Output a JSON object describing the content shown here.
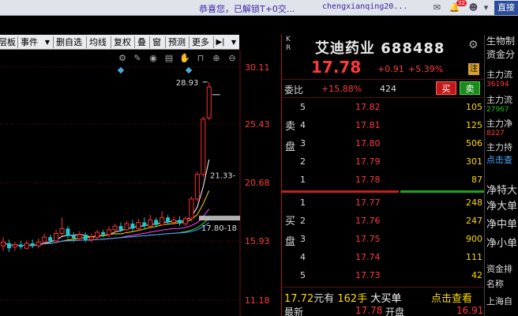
{
  "topbar": {
    "message": "恭喜您，已解锁T+0交...",
    "user": "chengxianqing20...",
    "mail_badge": "32",
    "back_label": "直接"
  },
  "chart_toolbar": {
    "items": [
      "层板",
      "事件",
      "删自选",
      "均线",
      "复权",
      "叠",
      "窗",
      "预测",
      "更多"
    ]
  },
  "chart_icons": [
    "settings-gear-icon",
    "pencil-icon",
    "eye-icon",
    "clipboard-icon",
    "hand-icon",
    "lock-icon",
    "zoom-in-icon",
    "zoom-out-icon"
  ],
  "chart_data": {
    "type": "candlestick",
    "y_axis_ticks": [
      "30.11",
      "25.43",
      "20.68",
      "15.93",
      "11.18"
    ],
    "annotations": {
      "high_marker": "28.93",
      "ma_label": "21.33-",
      "price_range_label": "17.80-18"
    },
    "candles": [
      {
        "o": 15.6,
        "c": 15.9,
        "h": 16.3,
        "l": 15.2
      },
      {
        "o": 15.8,
        "c": 15.4,
        "h": 16.1,
        "l": 15.1
      },
      {
        "o": 15.5,
        "c": 15.7,
        "h": 15.9,
        "l": 15.2
      },
      {
        "o": 15.7,
        "c": 15.5,
        "h": 16.0,
        "l": 15.3
      },
      {
        "o": 15.4,
        "c": 15.8,
        "h": 16.0,
        "l": 15.3
      },
      {
        "o": 15.8,
        "c": 15.6,
        "h": 16.1,
        "l": 15.4
      },
      {
        "o": 15.6,
        "c": 15.9,
        "h": 16.2,
        "l": 15.4
      },
      {
        "o": 15.9,
        "c": 16.3,
        "h": 16.6,
        "l": 15.7
      },
      {
        "o": 16.3,
        "c": 16.0,
        "h": 16.5,
        "l": 15.8
      },
      {
        "o": 16.0,
        "c": 16.6,
        "h": 16.9,
        "l": 15.9
      },
      {
        "o": 16.6,
        "c": 17.0,
        "h": 17.9,
        "l": 16.4
      },
      {
        "o": 17.0,
        "c": 16.4,
        "h": 17.2,
        "l": 16.2
      },
      {
        "o": 16.4,
        "c": 16.2,
        "h": 16.7,
        "l": 15.9
      },
      {
        "o": 16.2,
        "c": 16.5,
        "h": 16.8,
        "l": 16.0
      },
      {
        "o": 16.5,
        "c": 16.1,
        "h": 16.7,
        "l": 15.9
      },
      {
        "o": 16.1,
        "c": 16.3,
        "h": 16.6,
        "l": 15.9
      },
      {
        "o": 16.3,
        "c": 16.7,
        "h": 16.9,
        "l": 16.1
      },
      {
        "o": 16.7,
        "c": 16.5,
        "h": 16.9,
        "l": 16.3
      },
      {
        "o": 16.5,
        "c": 16.9,
        "h": 17.2,
        "l": 16.3
      },
      {
        "o": 16.9,
        "c": 17.2,
        "h": 17.4,
        "l": 16.7
      },
      {
        "o": 17.2,
        "c": 16.9,
        "h": 17.5,
        "l": 16.7
      },
      {
        "o": 16.9,
        "c": 17.4,
        "h": 17.6,
        "l": 16.8
      },
      {
        "o": 17.4,
        "c": 17.0,
        "h": 17.7,
        "l": 16.8
      },
      {
        "o": 17.0,
        "c": 17.5,
        "h": 17.8,
        "l": 16.9
      },
      {
        "o": 17.5,
        "c": 17.2,
        "h": 17.9,
        "l": 17.0
      },
      {
        "o": 17.2,
        "c": 17.7,
        "h": 18.1,
        "l": 17.0
      },
      {
        "o": 17.7,
        "c": 17.3,
        "h": 17.9,
        "l": 17.1
      },
      {
        "o": 17.3,
        "c": 17.9,
        "h": 18.4,
        "l": 17.2
      },
      {
        "o": 17.9,
        "c": 17.5,
        "h": 18.1,
        "l": 17.3
      },
      {
        "o": 17.5,
        "c": 17.7,
        "h": 18.0,
        "l": 17.3
      },
      {
        "o": 17.7,
        "c": 17.4,
        "h": 18.0,
        "l": 17.2
      },
      {
        "o": 17.4,
        "c": 17.8,
        "h": 18.0,
        "l": 17.2
      },
      {
        "o": 17.8,
        "c": 19.4,
        "h": 19.6,
        "l": 17.6
      },
      {
        "o": 19.4,
        "c": 21.4,
        "h": 21.6,
        "l": 19.2
      },
      {
        "o": 21.4,
        "c": 25.9,
        "h": 26.1,
        "l": 21.2
      },
      {
        "o": 26.0,
        "c": 28.5,
        "h": 28.9,
        "l": 25.8
      }
    ]
  },
  "quote": {
    "kr_labels": [
      "K",
      "R"
    ],
    "name": "艾迪药业",
    "code": "688488",
    "last_price": "17.78",
    "change": "+0.91",
    "change_pct": "+5.39%",
    "zhu_label": "注",
    "weibi_label": "委比",
    "weibi_value": "+15.88%",
    "weibi_count": "424",
    "buy_btn": "买",
    "sell_btn": "卖",
    "sell_side_label": [
      "卖",
      "盘"
    ],
    "buy_side_label": [
      "买",
      "盘"
    ],
    "asks": [
      {
        "level": "5",
        "price": "17.82",
        "vol": "105"
      },
      {
        "level": "4",
        "price": "17.81",
        "vol": "125"
      },
      {
        "level": "3",
        "price": "17.80",
        "vol": "506"
      },
      {
        "level": "2",
        "price": "17.79",
        "vol": "301"
      },
      {
        "level": "1",
        "price": "17.78",
        "vol": "87"
      }
    ],
    "bids": [
      {
        "level": "1",
        "price": "17.77",
        "vol": "248"
      },
      {
        "level": "2",
        "price": "17.76",
        "vol": "247"
      },
      {
        "level": "3",
        "price": "17.75",
        "vol": "900"
      },
      {
        "level": "4",
        "price": "17.74",
        "vol": "111"
      },
      {
        "level": "5",
        "price": "17.73",
        "vol": "42"
      }
    ],
    "bottom": {
      "price": "17.72",
      "unit_yuan": "元有",
      "qty": "162手",
      "big_buy": "大买单",
      "click_view": "点击查看"
    },
    "last_row": {
      "label_latest": "最新",
      "latest": "17.78",
      "label_open": "开盘",
      "open": "16.91"
    }
  },
  "strip": {
    "items": [
      {
        "text": "生物制",
        "color": "#dddddd"
      },
      {
        "text": "资金分",
        "color": "#dddddd"
      },
      {
        "text": "主力流",
        "color": "#dddddd"
      },
      {
        "text": "36194",
        "color": "#ff3a3a"
      },
      {
        "text": "主力流",
        "color": "#dddddd"
      },
      {
        "text": "27967",
        "color": "#20c020"
      },
      {
        "text": "主力净",
        "color": "#dddddd"
      },
      {
        "text": "8227",
        "color": "#ff3a3a"
      },
      {
        "text": "主力持",
        "color": "#dddddd"
      },
      {
        "text": "点击查",
        "color": "#4aa8ff"
      },
      {
        "text": "净特大",
        "color": "#dddddd"
      },
      {
        "text": "净大单",
        "color": "#dddddd"
      },
      {
        "text": "净中单",
        "color": "#dddddd"
      },
      {
        "text": "净小单",
        "color": "#dddddd"
      },
      {
        "text": "资金排",
        "color": "#dddddd"
      },
      {
        "text": "名称",
        "color": "#dddddd"
      },
      {
        "text": "上海自",
        "color": "#dddddd"
      }
    ]
  }
}
